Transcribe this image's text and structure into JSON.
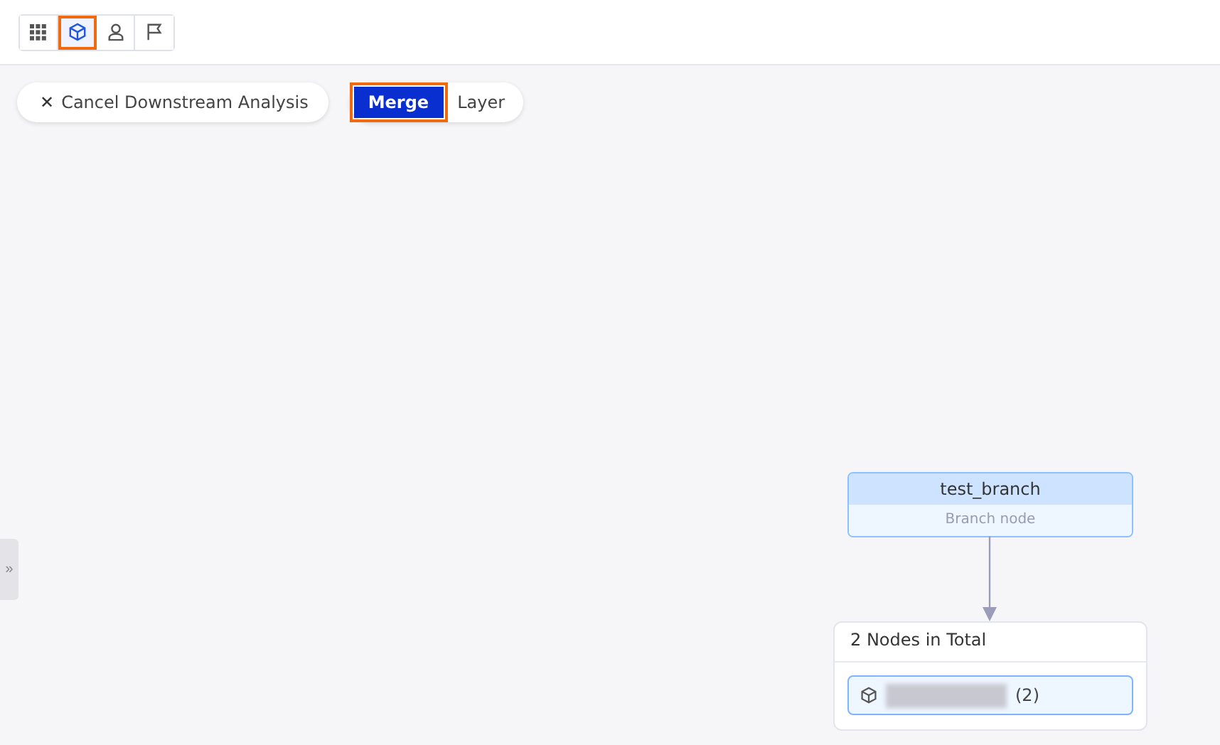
{
  "toolbar": {
    "buttons": [
      {
        "kind": "grid",
        "selected": false,
        "highlighted": false
      },
      {
        "kind": "cube",
        "selected": true,
        "highlighted": true
      },
      {
        "kind": "person",
        "selected": false,
        "highlighted": false
      },
      {
        "kind": "flag",
        "selected": false,
        "highlighted": false
      }
    ]
  },
  "cancel_button": {
    "icon": "✕",
    "label": "Cancel Downstream Analysis"
  },
  "view_toggle": [
    {
      "label": "Merge",
      "selected": true,
      "highlighted": true
    },
    {
      "label": "Layer",
      "selected": false,
      "highlighted": false
    }
  ],
  "side_handle": "»",
  "graph": {
    "node": {
      "title": "test_branch",
      "subtitle": "Branch node"
    },
    "group": {
      "title": "2 Nodes in Total",
      "items": [
        {
          "name_redacted": true,
          "count": "(2)"
        }
      ]
    }
  }
}
